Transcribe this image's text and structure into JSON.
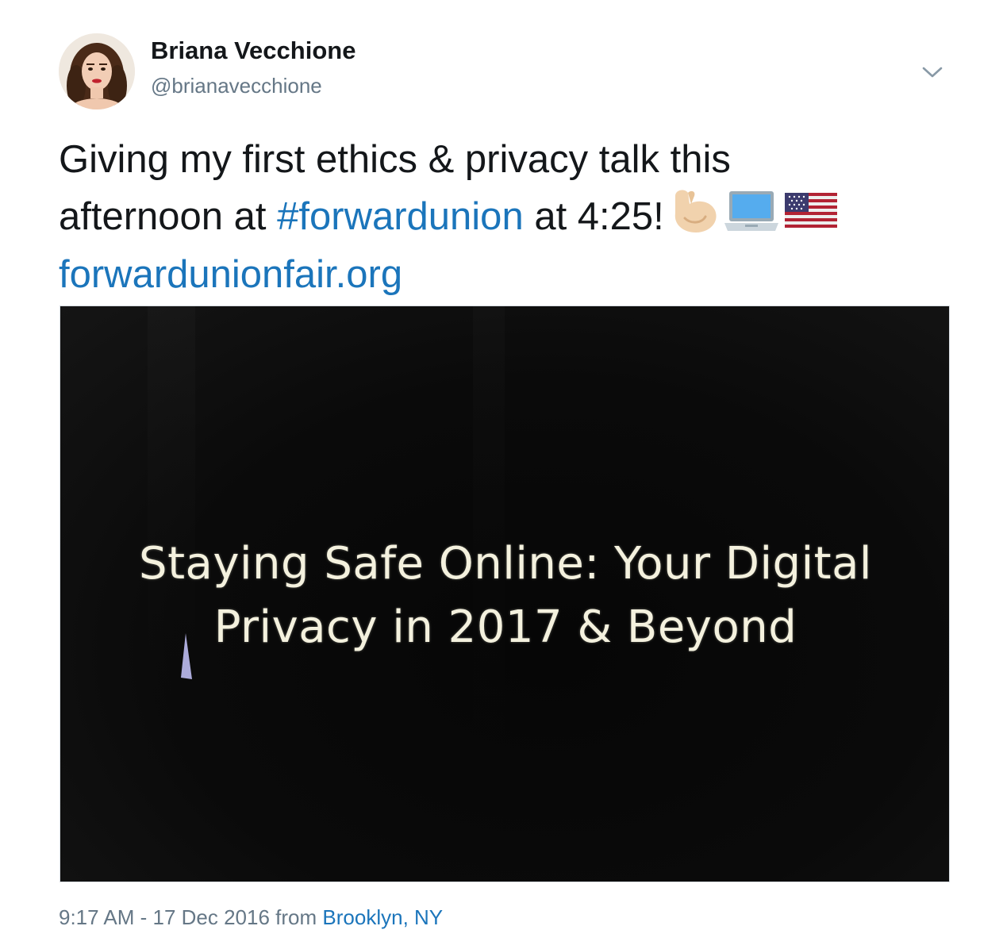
{
  "author": {
    "display_name": "Briana Vecchione",
    "handle": "@brianavecchione",
    "avatar_icon": "profile-photo"
  },
  "menu": {
    "icon": "chevron-down-icon"
  },
  "tweet": {
    "line1": "Giving my first ethics & privacy talk this",
    "line2_prefix": "afternoon at ",
    "hashtag": "#forwardunion",
    "line2_suffix": " at 4:25!",
    "emojis": [
      "flexed-biceps-emoji",
      "laptop-emoji",
      "us-flag-emoji"
    ],
    "url": "forwardunionfair.org"
  },
  "media": {
    "slide_title_line1": "Staying Safe Online: Your Digital",
    "slide_title_line2": "Privacy in 2017 & Beyond"
  },
  "footer": {
    "time_date": "9:17 AM - 17 Dec 2016",
    "from_label": " from ",
    "location": "Brooklyn, NY"
  },
  "colors": {
    "link": "#1b75bb",
    "secondary_text": "#657786",
    "primary_text": "#14171a"
  }
}
